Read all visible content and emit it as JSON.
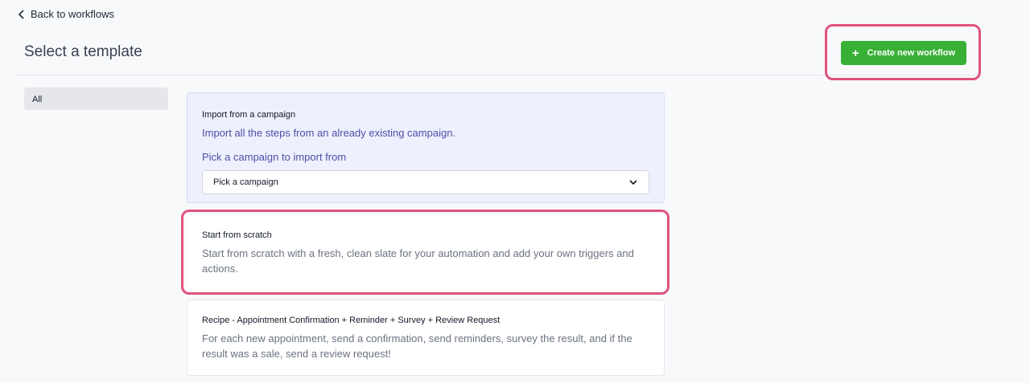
{
  "nav": {
    "back_label": "Back to workflows"
  },
  "header": {
    "title": "Select a template",
    "create_label": "Create new workflow"
  },
  "sidebar": {
    "items": [
      {
        "label": "All"
      }
    ]
  },
  "templates": {
    "import": {
      "title": "Import from a campaign",
      "description": "Import all the steps from an already existing campaign.",
      "pick_label": "Pick a campaign to import from",
      "select_value": "Pick a campaign"
    },
    "scratch": {
      "title": "Start from scratch",
      "description": "Start from scratch with a fresh, clean slate for your automation and add your own triggers and actions."
    },
    "recipe": {
      "title": "Recipe - Appointment Confirmation + Reminder + Survey + Review Request",
      "description": "For each new appointment, send a confirmation, send reminders, survey the result, and if the result was a sale, send a review request!"
    }
  },
  "colors": {
    "accent_green": "#37b035",
    "highlight": "#e0537a",
    "import_bg": "#eef0fd"
  }
}
